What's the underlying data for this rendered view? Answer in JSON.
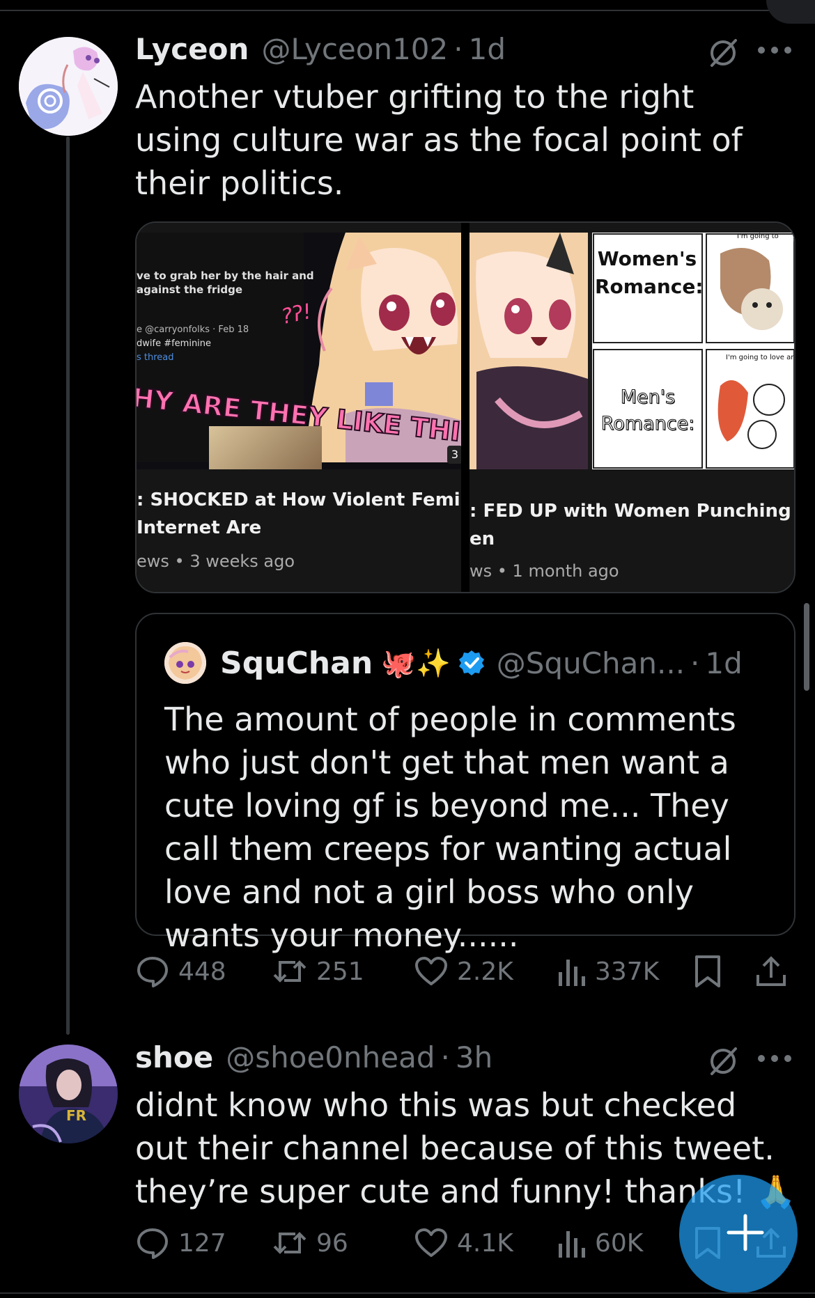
{
  "colors": {
    "background": "#000000",
    "text": "#e7e9ea",
    "muted": "#71767b",
    "border": "#2f3336",
    "accent": "#1d9bf0"
  },
  "tweet1": {
    "name": "Lyceon",
    "handle": "@Lyceon102",
    "separator": "·",
    "time": "1d",
    "text": "Another vtuber grifting to the right using culture war as the focal point of their politics.",
    "media": [
      {
        "thumb_caption_lines": [
          "ve to grab her by the hair and",
          "against the fridge"
        ],
        "thumb_meta_lines": [
          "e @carryonfolks · Feb 18",
          "dwife #feminine",
          "s thread"
        ],
        "thumb_banner": "HY ARE THEY LIKE THI",
        "thumb_badge": "3",
        "thumb_scribble": "?ʔ!",
        "title_lines": [
          ": SHOCKED at How Violent Feminists",
          "Internet Are"
        ],
        "meta": "ews • 3 weeks ago"
      },
      {
        "panel_top_label": "Women's Romance:",
        "panel_bottom_label": "Men's Romance:",
        "comic_top_caption": "I'm going to",
        "comic_bottom_caption": "I'm going to love ar",
        "title_lines": [
          ": FED UP with Women Punching Down",
          "en"
        ],
        "meta": "ws • 1 month ago"
      }
    ],
    "quote": {
      "name": "SquChan",
      "emojis": "🐙✨",
      "handle": "@SquChan...",
      "separator": "·",
      "time": "1d",
      "text": "The amount of people in comments who just don't get that men want a cute loving gf is beyond me... They call them creeps for wanting actual love and not a girl boss who only wants your money......"
    },
    "actions": {
      "replies": "448",
      "reposts": "251",
      "likes": "2.2K",
      "views": "337K"
    }
  },
  "tweet2": {
    "name": "shoe",
    "handle": "@shoe0nhead",
    "separator": "·",
    "time": "3h",
    "text": "didnt know who this was but checked out their channel because of this tweet. they’re super cute and funny! thanks! 🙏",
    "avatar_text": "FR",
    "actions": {
      "replies": "127",
      "reposts": "96",
      "likes": "4.1K",
      "views": "60K"
    }
  },
  "icons": {
    "reply": "reply-icon",
    "repost": "repost-icon",
    "like": "heart-icon",
    "views": "views-icon",
    "bookmark": "bookmark-icon",
    "share": "share-icon",
    "grok": "grok-icon",
    "more": "more-icon",
    "verified": "verified-badge-icon",
    "compose": "compose-plus-icon"
  }
}
